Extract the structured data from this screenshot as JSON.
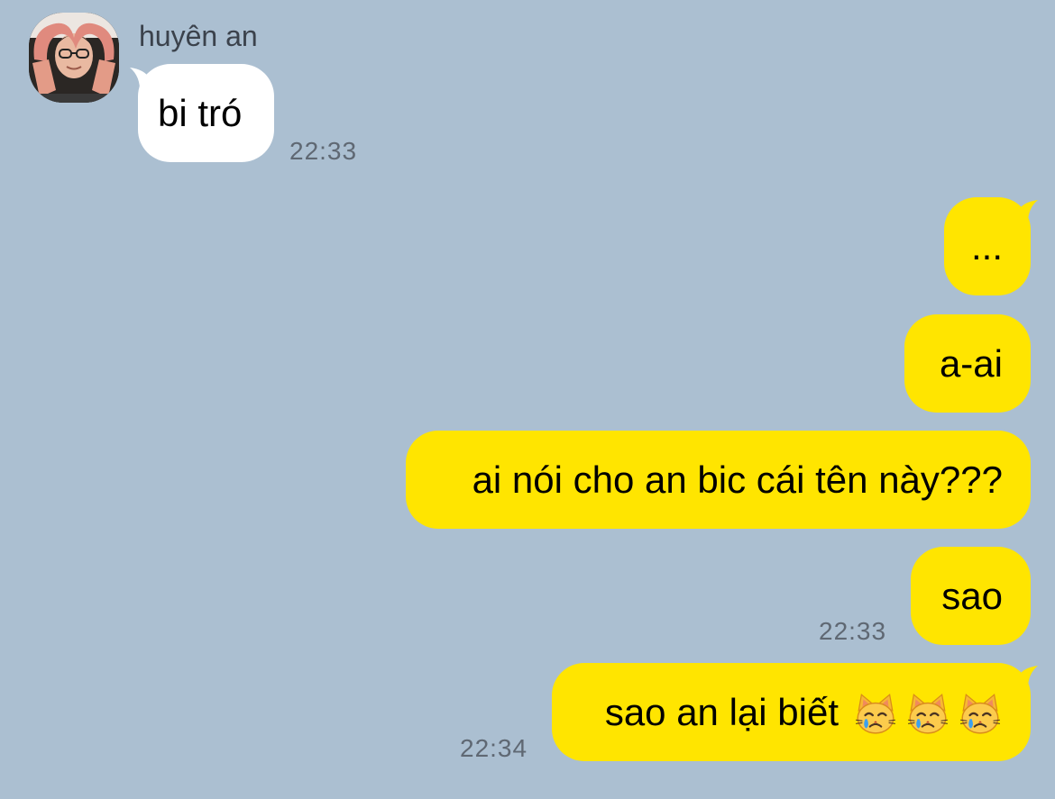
{
  "incoming": {
    "sender_name": "huyên an",
    "messages": [
      {
        "text": "bi tró",
        "time": "22:33"
      }
    ]
  },
  "outgoing": {
    "messages": [
      {
        "text": "..."
      },
      {
        "text": "a-ai"
      },
      {
        "text": "ai nói cho an bic cái tên này???"
      },
      {
        "text": "sao",
        "time": "22:33"
      },
      {
        "text": "sao an lại biết",
        "emoji": [
          "crying-cat-face",
          "crying-cat-face",
          "crying-cat-face"
        ],
        "time": "22:34"
      }
    ]
  },
  "colors": {
    "background": "#abbfd1",
    "outgoing_bubble": "#ffe500",
    "incoming_bubble": "#ffffff"
  }
}
